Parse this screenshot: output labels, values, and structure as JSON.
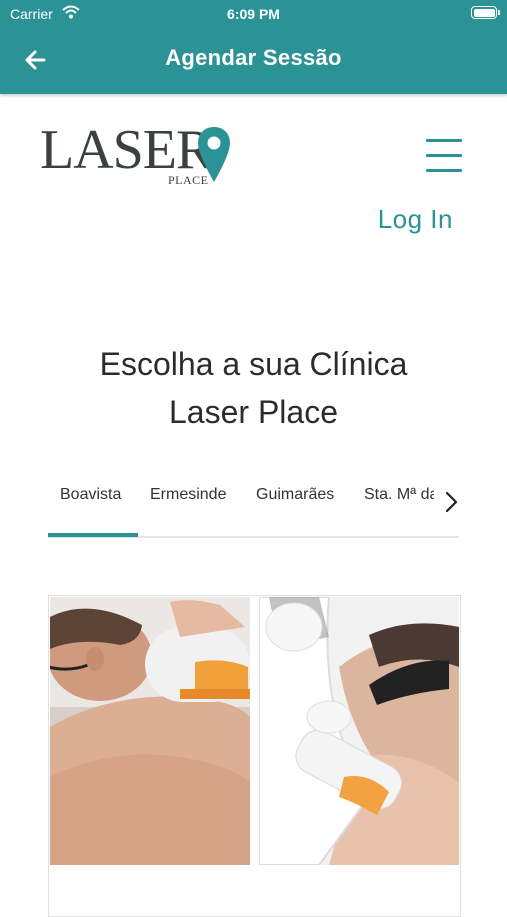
{
  "status_bar": {
    "carrier": "Carrier",
    "time": "6:09 PM"
  },
  "header": {
    "title": "Agendar Sessão",
    "back_icon": "arrow-left-icon"
  },
  "logo": {
    "word": "LASER",
    "sub": "PLACE"
  },
  "menu_icon": "hamburger-menu-icon",
  "login_label": "Log In",
  "heading": {
    "line1": "Escolha a sua Clínica",
    "line2": "Laser Place"
  },
  "tabs": [
    "Boavista",
    "Ermesinde",
    "Guimarães",
    "Sta. Mª da"
  ],
  "active_tab": "Boavista",
  "colors": {
    "primary": "#2b9396",
    "text": "#2a2d2e"
  }
}
